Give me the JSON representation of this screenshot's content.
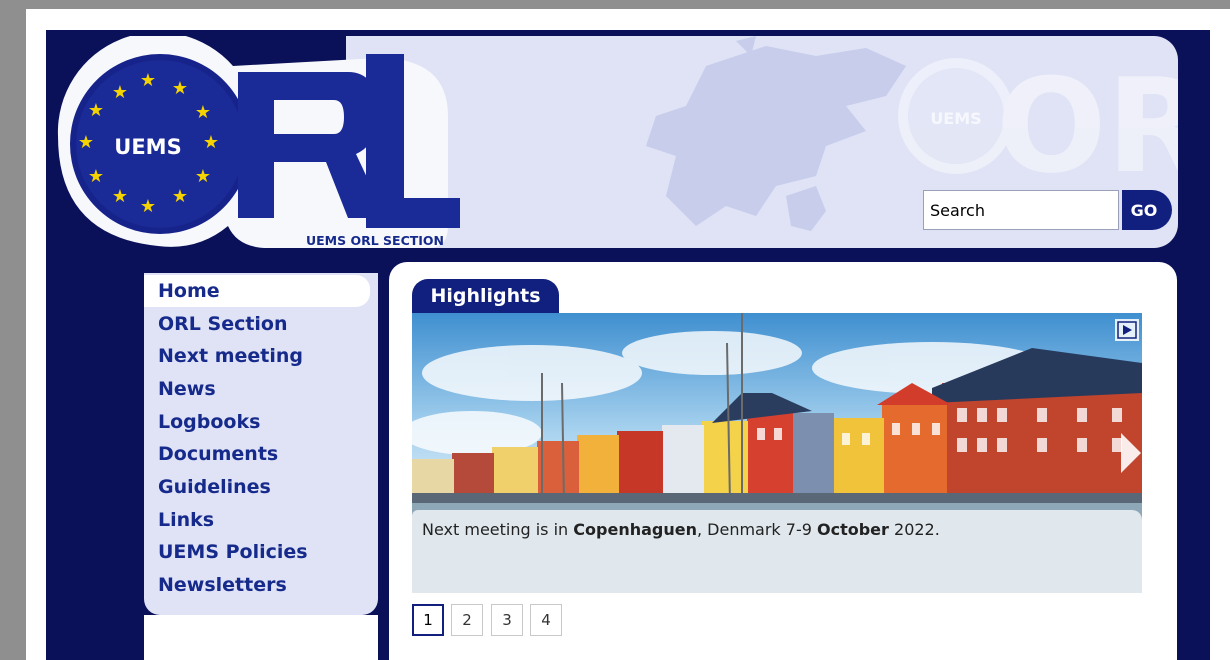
{
  "logo": {
    "badge": "UEMS",
    "wordmark": "ORL",
    "subtitle": "UEMS ORL SECTION"
  },
  "search": {
    "value": "Search",
    "go_label": "GO"
  },
  "sidebar": {
    "items": [
      {
        "label": "Home"
      },
      {
        "label": "ORL Section"
      },
      {
        "label": "Next meeting"
      },
      {
        "label": "News"
      },
      {
        "label": "Logbooks"
      },
      {
        "label": "Documents"
      },
      {
        "label": "Guidelines"
      },
      {
        "label": "Links"
      },
      {
        "label": "UEMS Policies"
      },
      {
        "label": "Newsletters"
      }
    ]
  },
  "main": {
    "tab_label": "Highlights",
    "caption": {
      "part1": "Next meeting is in ",
      "city": "Copenhaguen",
      "part2": ", Denmark 7-9 ",
      "month": "October",
      "part3": " 2022."
    },
    "pager": [
      "1",
      "2",
      "3",
      "4"
    ],
    "current_page": 1
  },
  "colors": {
    "navy": "#0b1159",
    "accent": "#11207e",
    "nav_text": "#162a8c",
    "panel_light": "#dfe3f5",
    "star": "#f5d300"
  }
}
